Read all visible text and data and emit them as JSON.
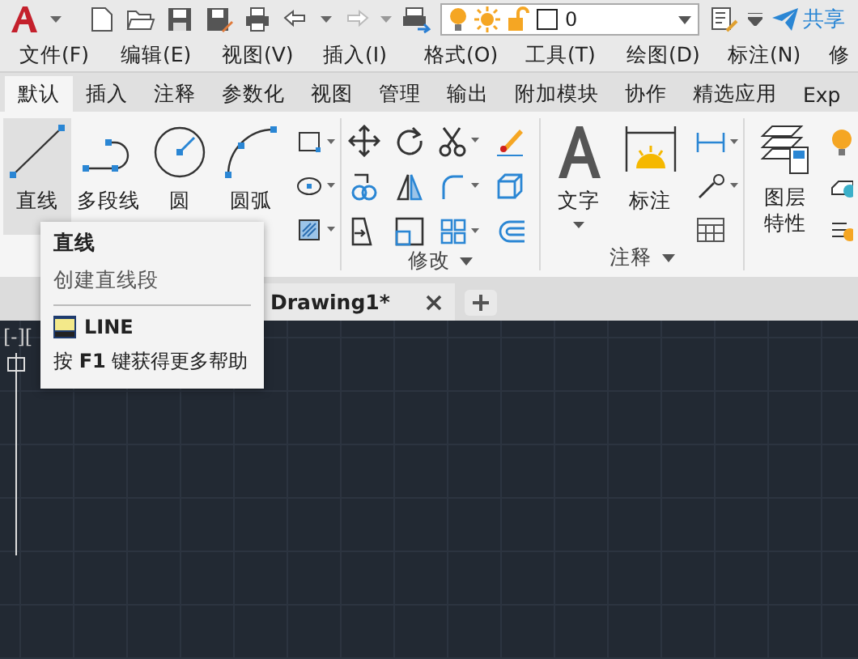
{
  "quick_access": {
    "layer_value": "0",
    "share": "共享"
  },
  "menu": [
    "文件(F)",
    "编辑(E)",
    "视图(V)",
    "插入(I)",
    "格式(O)",
    "工具(T)",
    "绘图(D)",
    "标注(N)",
    "修"
  ],
  "ribbon_tabs": [
    {
      "label": "默认",
      "selected": true
    },
    {
      "label": "插入",
      "selected": false
    },
    {
      "label": "注释",
      "selected": false
    },
    {
      "label": "参数化",
      "selected": false
    },
    {
      "label": "视图",
      "selected": false
    },
    {
      "label": "管理",
      "selected": false
    },
    {
      "label": "输出",
      "selected": false
    },
    {
      "label": "附加模块",
      "selected": false
    },
    {
      "label": "协作",
      "selected": false
    },
    {
      "label": "精选应用",
      "selected": false
    },
    {
      "label": "Exp",
      "selected": false
    }
  ],
  "draw_panel": {
    "tools": [
      {
        "label": "直线",
        "highlighted": true
      },
      {
        "label": "多段线",
        "highlighted": false
      },
      {
        "label": "圆",
        "highlighted": false
      },
      {
        "label": "圆弧",
        "highlighted": false
      }
    ]
  },
  "modify_panel": {
    "title": "修改"
  },
  "annotation_panel": {
    "title": "注释",
    "text_tool": "文字",
    "dimension_tool": "标注"
  },
  "layers_panel": {
    "layer_properties": "图层特性"
  },
  "file_tabs": [
    {
      "label": "Drawing1*"
    }
  ],
  "viewport_label": "[-][",
  "tooltip": {
    "title": "直线",
    "description": "创建直线段",
    "command": "LINE",
    "help": "按 **F1** 键获得更多帮助"
  }
}
